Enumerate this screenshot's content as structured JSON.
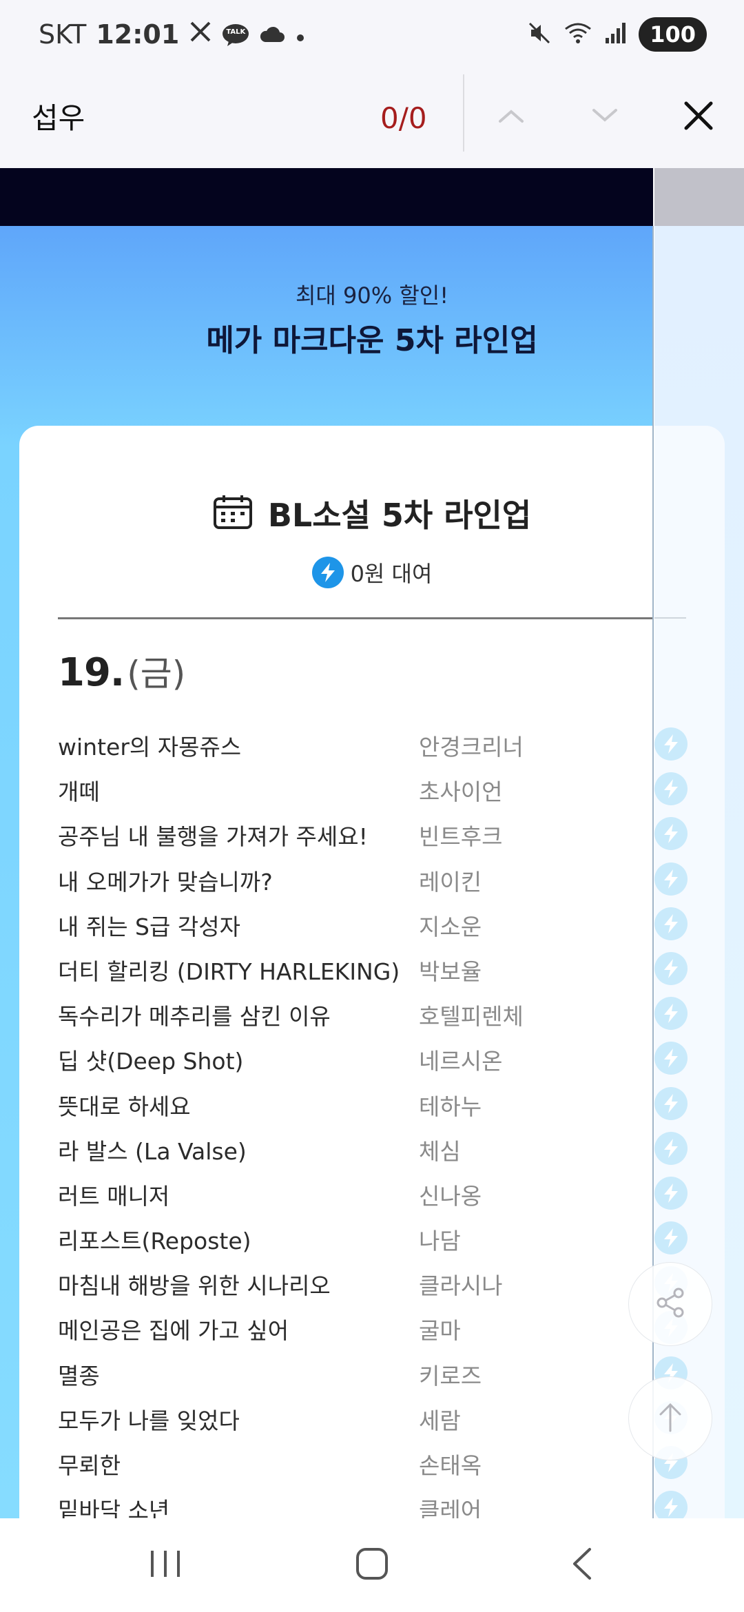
{
  "status_bar": {
    "carrier": "SKT",
    "time": "12:01",
    "talk_badge": "TALK",
    "battery": "100",
    "icons": [
      "x-app-icon",
      "kakaotalk-icon",
      "cloud-icon",
      "dot-icon",
      "mute-icon",
      "wifi-icon",
      "signal-icon"
    ]
  },
  "find_bar": {
    "query": "섭우",
    "match_count": "0/0",
    "icons": [
      "chevron-up-icon",
      "chevron-down-icon",
      "close-icon"
    ]
  },
  "promo": {
    "subtitle": "최대 90% 할인!",
    "title": "메가 마크다운 5차 라인업"
  },
  "lineup": {
    "title": "BL소설 5차 라인업",
    "badge_text": "0원 대여",
    "date_number": "19.",
    "date_day": "(금)",
    "books": [
      {
        "title": "winter의 자몽쥬스",
        "author": "안경크리너"
      },
      {
        "title": "개떼",
        "author": "초사이언"
      },
      {
        "title": "공주님 내 불행을 가져가 주세요!",
        "author": "빈트후크"
      },
      {
        "title": "내 오메가가 맞습니까?",
        "author": "레이킨"
      },
      {
        "title": "내 쥐는 S급 각성자",
        "author": "지소운"
      },
      {
        "title": "더티 할리킹 (DIRTY HARLEKING)",
        "author": "박보율"
      },
      {
        "title": "독수리가 메추리를 삼킨 이유",
        "author": "호텔피렌체"
      },
      {
        "title": "딥 샷(Deep Shot)",
        "author": "네르시온"
      },
      {
        "title": "뜻대로 하세요",
        "author": "테하누"
      },
      {
        "title": "라 발스 (La Valse)",
        "author": "체심"
      },
      {
        "title": "러트 매니저",
        "author": "신나옹"
      },
      {
        "title": "리포스트(Reposte)",
        "author": "나담"
      },
      {
        "title": "마침내 해방을 위한 시나리오",
        "author": "클라시나"
      },
      {
        "title": "메인공은 집에 가고 싶어",
        "author": "굴마"
      },
      {
        "title": "멸종",
        "author": "키로즈"
      },
      {
        "title": "모두가 나를 잊었다",
        "author": "세람"
      },
      {
        "title": "무뢰한",
        "author": "손태옥"
      },
      {
        "title": "밑바닥 소년",
        "author": "클레어"
      }
    ]
  },
  "floating_buttons": [
    "share-icon",
    "arrow-up-icon"
  ],
  "nav_bar": [
    "recent-apps-icon",
    "home-icon",
    "back-icon"
  ],
  "colors": {
    "match_count": "#a51d1d",
    "promo_gradient_top": "#5fa6fa",
    "promo_gradient_bottom": "#86dcff",
    "bolt_badge": "#1e95e8",
    "row_bolt": "#c9eafb"
  }
}
